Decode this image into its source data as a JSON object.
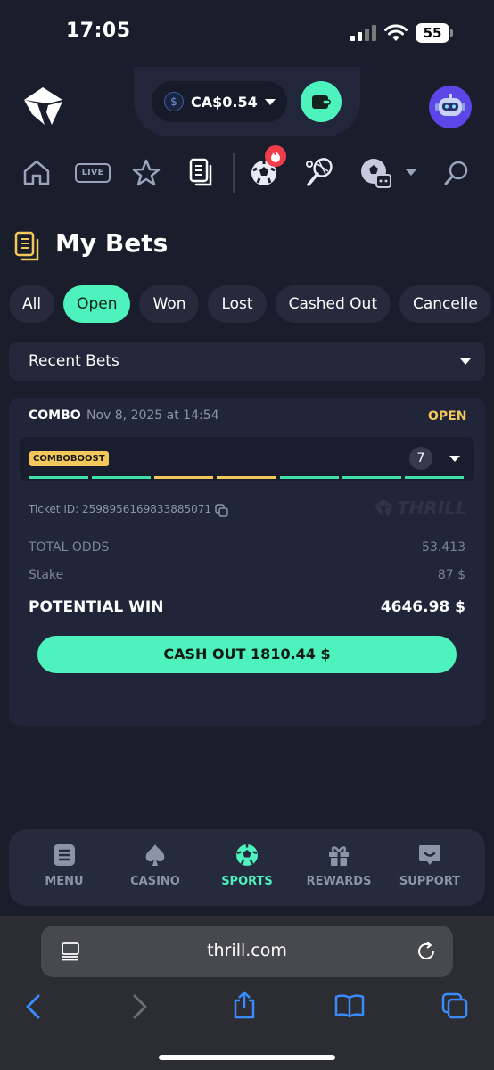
{
  "status_bar": {
    "time": "17:05",
    "battery": "55"
  },
  "header": {
    "balance": "CA$0.54"
  },
  "nav": {
    "live_label": "LIVE"
  },
  "page": {
    "title": "My Bets"
  },
  "filters": {
    "chips": [
      {
        "label": "All",
        "active": false
      },
      {
        "label": "Open",
        "active": true
      },
      {
        "label": "Won",
        "active": false
      },
      {
        "label": "Lost",
        "active": false
      },
      {
        "label": "Cashed Out",
        "active": false
      },
      {
        "label": "Cancelle",
        "active": false
      }
    ]
  },
  "recent": {
    "label": "Recent Bets"
  },
  "bet": {
    "type": "COMBO",
    "date": "Nov 8, 2025 at 14:54",
    "status": "OPEN",
    "boost_badge": "COMBOBOOST",
    "leg_count": "7",
    "leg_colors": [
      "#3ee0a8",
      "#3ee0a8",
      "#f3c85a",
      "#f3c85a",
      "#3ee0a8",
      "#3ee0a8",
      "#3ee0a8"
    ],
    "ticket_id": "Ticket ID: 2598956169833885071",
    "watermark": "THRILL",
    "total_odds_label": "TOTAL ODDS",
    "total_odds_value": "53.413",
    "stake_label": "Stake",
    "stake_value": "87 $",
    "potential_win_label": "POTENTIAL WIN",
    "potential_win_value": "4646.98 $",
    "cashout_label": "CASH OUT 1810.44 $"
  },
  "tabbar": {
    "tabs": [
      {
        "label": "MENU",
        "icon": "menu-icon"
      },
      {
        "label": "CASINO",
        "icon": "spade-icon"
      },
      {
        "label": "SPORTS",
        "icon": "soccer-ball-icon"
      },
      {
        "label": "REWARDS",
        "icon": "gift-icon"
      },
      {
        "label": "SUPPORT",
        "icon": "chat-icon"
      }
    ]
  },
  "browser": {
    "url": "thrill.com"
  },
  "colors": {
    "accent": "#4ef2bc",
    "status_open": "#f3c85a",
    "background": "#1a1d2b"
  }
}
